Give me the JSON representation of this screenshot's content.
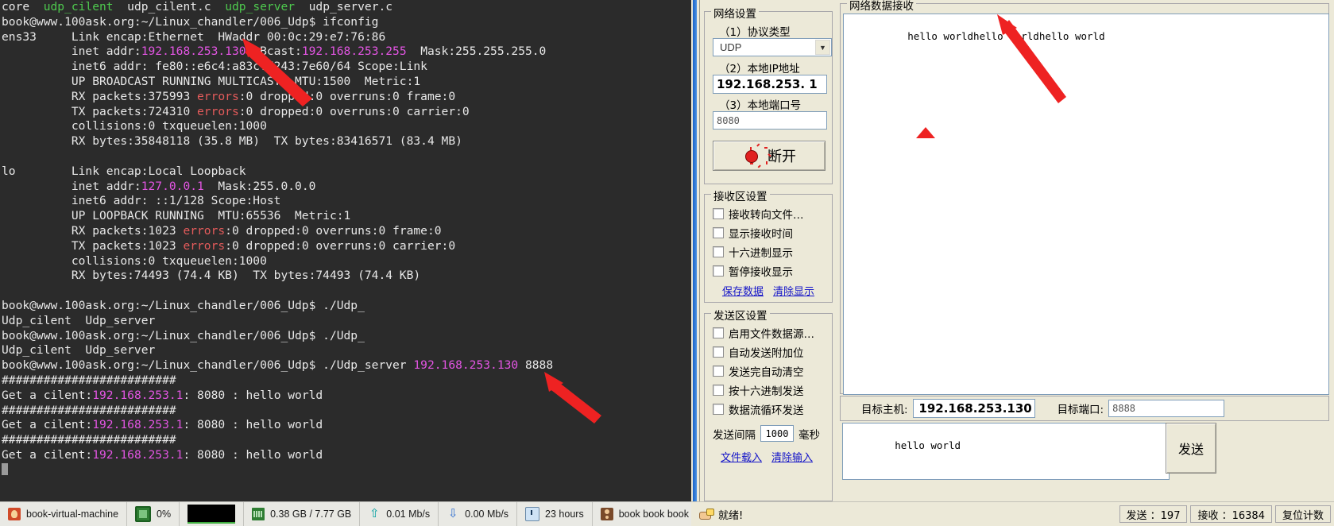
{
  "terminal": {
    "lines": [
      {
        "segs": [
          {
            "t": "core  ",
            "c": "white"
          },
          {
            "t": "udp_cilent",
            "c": "green"
          },
          {
            "t": "  udp_cilent.c  ",
            "c": "white"
          },
          {
            "t": "udp_server",
            "c": "green"
          },
          {
            "t": "  udp_server.c",
            "c": "white"
          }
        ]
      },
      {
        "segs": [
          {
            "t": "book@www.100ask.org:~/Linux_chandler/006_Udp$ ifconfig",
            "c": "white"
          }
        ]
      },
      {
        "segs": [
          {
            "t": "ens33     Link encap:Ethernet  HWaddr 00:0c:29:e7:76:86",
            "c": "white"
          }
        ]
      },
      {
        "segs": [
          {
            "t": "          inet addr:",
            "c": "white"
          },
          {
            "t": "192.168.253.130",
            "c": "magenta"
          },
          {
            "t": "  Bcast:",
            "c": "white"
          },
          {
            "t": "192.168.253.255",
            "c": "magenta"
          },
          {
            "t": "  Mask:255.255.255.0",
            "c": "white"
          }
        ]
      },
      {
        "segs": [
          {
            "t": "          inet6 addr: fe80::e6c4:a83c:7243:7e60/64 Scope:Link",
            "c": "white"
          }
        ]
      },
      {
        "segs": [
          {
            "t": "          UP BROADCAST RUNNING MULTICAST  MTU:1500  Metric:1",
            "c": "white"
          }
        ]
      },
      {
        "segs": [
          {
            "t": "          RX packets:375993 ",
            "c": "white"
          },
          {
            "t": "errors",
            "c": "red"
          },
          {
            "t": ":0 dropped:0 overruns:0 frame:0",
            "c": "white"
          }
        ]
      },
      {
        "segs": [
          {
            "t": "          TX packets:724310 ",
            "c": "white"
          },
          {
            "t": "errors",
            "c": "red"
          },
          {
            "t": ":0 dropped:0 overruns:0 carrier:0",
            "c": "white"
          }
        ]
      },
      {
        "segs": [
          {
            "t": "          collisions:0 txqueuelen:1000",
            "c": "white"
          }
        ]
      },
      {
        "segs": [
          {
            "t": "          RX bytes:35848118 (35.8 MB)  TX bytes:83416571 (83.4 MB)",
            "c": "white"
          }
        ]
      },
      {
        "segs": [
          {
            "t": "",
            "c": "white"
          }
        ]
      },
      {
        "segs": [
          {
            "t": "lo        Link encap:Local Loopback",
            "c": "white"
          }
        ]
      },
      {
        "segs": [
          {
            "t": "          inet addr:",
            "c": "white"
          },
          {
            "t": "127.0.0.1",
            "c": "magenta"
          },
          {
            "t": "  Mask:255.0.0.0",
            "c": "white"
          }
        ]
      },
      {
        "segs": [
          {
            "t": "          inet6 addr: ::1/128 Scope:Host",
            "c": "white"
          }
        ]
      },
      {
        "segs": [
          {
            "t": "          UP LOOPBACK RUNNING  MTU:65536  Metric:1",
            "c": "white"
          }
        ]
      },
      {
        "segs": [
          {
            "t": "          RX packets:1023 ",
            "c": "white"
          },
          {
            "t": "errors",
            "c": "red"
          },
          {
            "t": ":0 dropped:0 overruns:0 frame:0",
            "c": "white"
          }
        ]
      },
      {
        "segs": [
          {
            "t": "          TX packets:1023 ",
            "c": "white"
          },
          {
            "t": "errors",
            "c": "red"
          },
          {
            "t": ":0 dropped:0 overruns:0 carrier:0",
            "c": "white"
          }
        ]
      },
      {
        "segs": [
          {
            "t": "          collisions:0 txqueuelen:1000",
            "c": "white"
          }
        ]
      },
      {
        "segs": [
          {
            "t": "          RX bytes:74493 (74.4 KB)  TX bytes:74493 (74.4 KB)",
            "c": "white"
          }
        ]
      },
      {
        "segs": [
          {
            "t": "",
            "c": "white"
          }
        ]
      },
      {
        "segs": [
          {
            "t": "book@www.100ask.org:~/Linux_chandler/006_Udp$ ./Udp_",
            "c": "white"
          }
        ]
      },
      {
        "segs": [
          {
            "t": "Udp_cilent  Udp_server",
            "c": "white"
          }
        ]
      },
      {
        "segs": [
          {
            "t": "book@www.100ask.org:~/Linux_chandler/006_Udp$ ./Udp_",
            "c": "white"
          }
        ]
      },
      {
        "segs": [
          {
            "t": "Udp_cilent  Udp_server",
            "c": "white"
          }
        ]
      },
      {
        "segs": [
          {
            "t": "book@www.100ask.org:~/Linux_chandler/006_Udp$ ./Udp_server ",
            "c": "white"
          },
          {
            "t": "192.168.253.130",
            "c": "magenta"
          },
          {
            "t": " 8888",
            "c": "white"
          }
        ]
      },
      {
        "segs": [
          {
            "t": "#########################",
            "c": "white"
          }
        ]
      },
      {
        "segs": [
          {
            "t": "Get a cilent:",
            "c": "white"
          },
          {
            "t": "192.168.253.1",
            "c": "magenta"
          },
          {
            "t": ": 8080 : hello world",
            "c": "white"
          }
        ]
      },
      {
        "segs": [
          {
            "t": "#########################",
            "c": "white"
          }
        ]
      },
      {
        "segs": [
          {
            "t": "Get a cilent:",
            "c": "white"
          },
          {
            "t": "192.168.253.1",
            "c": "magenta"
          },
          {
            "t": ": 8080 : hello world",
            "c": "white"
          }
        ]
      },
      {
        "segs": [
          {
            "t": "#########################",
            "c": "white"
          }
        ]
      },
      {
        "segs": [
          {
            "t": "Get a cilent:",
            "c": "white"
          },
          {
            "t": "192.168.253.1",
            "c": "magenta"
          },
          {
            "t": ": 8080 : hello world",
            "c": "white"
          }
        ]
      }
    ],
    "status_bar": {
      "vm_name": "book-virtual-machine",
      "cpu_percent": "0%",
      "memory": "0.38 GB / 7.77 GB",
      "upload_rate": "0.01 Mb/s",
      "download_rate": "0.00 Mb/s",
      "uptime": "23 hours",
      "users": "book  book  book"
    }
  },
  "app": {
    "network_settings": {
      "title": "网络设置",
      "protocol_label": "（1）协议类型",
      "protocol_value": "UDP",
      "local_ip_label": "（2）本地IP地址",
      "local_ip_value": "192.168.253. 1",
      "local_port_label": "（3）本地端口号",
      "local_port_value": "8080",
      "connect_button": "断开"
    },
    "receive_settings": {
      "title": "接收区设置",
      "options": [
        "接收转向文件…",
        "显示接收时间",
        "十六进制显示",
        "暂停接收显示"
      ],
      "save_link": "保存数据",
      "clear_link": "清除显示"
    },
    "send_settings": {
      "title": "发送区设置",
      "options": [
        "启用文件数据源…",
        "自动发送附加位",
        "发送完自动清空",
        "按十六进制发送",
        "数据流循环发送"
      ],
      "interval_label": "发送间隔",
      "interval_value": "1000",
      "interval_unit": "毫秒",
      "load_file_link": "文件载入",
      "clear_input_link": "清除输入"
    },
    "data_panel": {
      "title": "网络数据接收",
      "received_text": "hello worldhello worldhello world",
      "target_host_label": "目标主机:",
      "target_host_value": "192.168.253.130",
      "target_port_label": "目标端口:",
      "target_port_value": "8888",
      "send_text": "hello world",
      "send_button": "发送"
    },
    "status_bar": {
      "ready": "就绪!",
      "sent_label": "发送 ：197",
      "recv_label": "接收 ：16384",
      "reset_label": "复位计数"
    }
  }
}
